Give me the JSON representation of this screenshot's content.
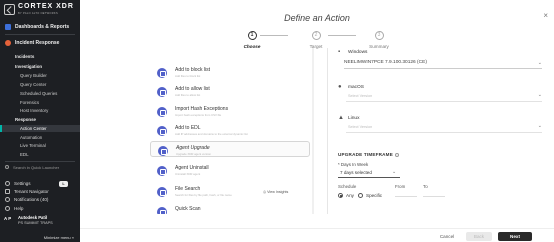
{
  "sidebar": {
    "logo_text": "CORTEX XDR",
    "logo_sub": "BY PALO ALTO NETWORKS",
    "dashboards": "Dashboards & Reports",
    "incident": "Incident Response",
    "items": [
      {
        "label": "Incidents",
        "type": "sub"
      },
      {
        "label": "Investigation",
        "type": "sub"
      },
      {
        "label": "Query Builder",
        "type": "leaf"
      },
      {
        "label": "Query Center",
        "type": "leaf"
      },
      {
        "label": "Scheduled Queries",
        "type": "leaf"
      },
      {
        "label": "Forensics",
        "type": "leaf"
      },
      {
        "label": "Host Inventory",
        "type": "leaf"
      },
      {
        "label": "Response",
        "type": "sub"
      },
      {
        "label": "Action Center",
        "type": "leaf-active"
      },
      {
        "label": "Automation",
        "type": "leaf"
      },
      {
        "label": "Live Terminal",
        "type": "leaf"
      },
      {
        "label": "EDL",
        "type": "leaf"
      }
    ],
    "search": "Search in Quick Launcher",
    "settings": "Settings",
    "lang": "L",
    "tenant": "Tenant Navigator",
    "notifications": "Notifications (40)",
    "help": "Help",
    "avatar": "A P",
    "user_name": "Autodesk Patil",
    "user_org": "PS SUMMIT TRAPS",
    "minimize": "Minimize menu"
  },
  "main": {
    "title": "Define an Action",
    "steps": [
      {
        "num": "1",
        "label": "Choose"
      },
      {
        "num": "2",
        "label": "Target"
      },
      {
        "num": "3",
        "label": "Summary"
      }
    ],
    "actions": [
      {
        "name": "Add to block list",
        "desc": "Add files to block list"
      },
      {
        "name": "Add to allow list",
        "desc": "Add files to allow list"
      },
      {
        "name": "Import Hash Exceptions",
        "desc": "Import hash exceptions from CSV file"
      },
      {
        "name": "Add to EDL",
        "desc": "Add IP addresses and domains to the external dynamic list"
      },
      {
        "name": "Agent Upgrade",
        "desc": "Upgrade XDR agent version"
      },
      {
        "name": "Agent Uninstall",
        "desc": "Uninstall XDR agent"
      },
      {
        "name": "File Search",
        "desc": "Search for files by file path, hash, or file name"
      },
      {
        "name": "Quick Scan",
        "desc": ""
      }
    ],
    "view_insights": "View Insights",
    "windows_label": "Windows",
    "windows_value": "NEELIMWIN7PCE 7.9.100.30126 (CE)",
    "os": [
      {
        "icon": "apple-icon",
        "name": "macOS",
        "placeholder": "Select Version"
      },
      {
        "icon": "linux-icon",
        "name": "Linux",
        "placeholder": "Select Version"
      }
    ],
    "upgrade_title": "UPGRADE TIMEFRAME",
    "days_label": "* Days In Week",
    "days_value": "7 days selected",
    "schedule_label": "Schedule",
    "from_label": "From",
    "to_label": "To",
    "radio_any": "Any",
    "radio_specific": "Specific"
  },
  "footer": {
    "cancel": "Cancel",
    "back": "Back",
    "next": "Next"
  }
}
